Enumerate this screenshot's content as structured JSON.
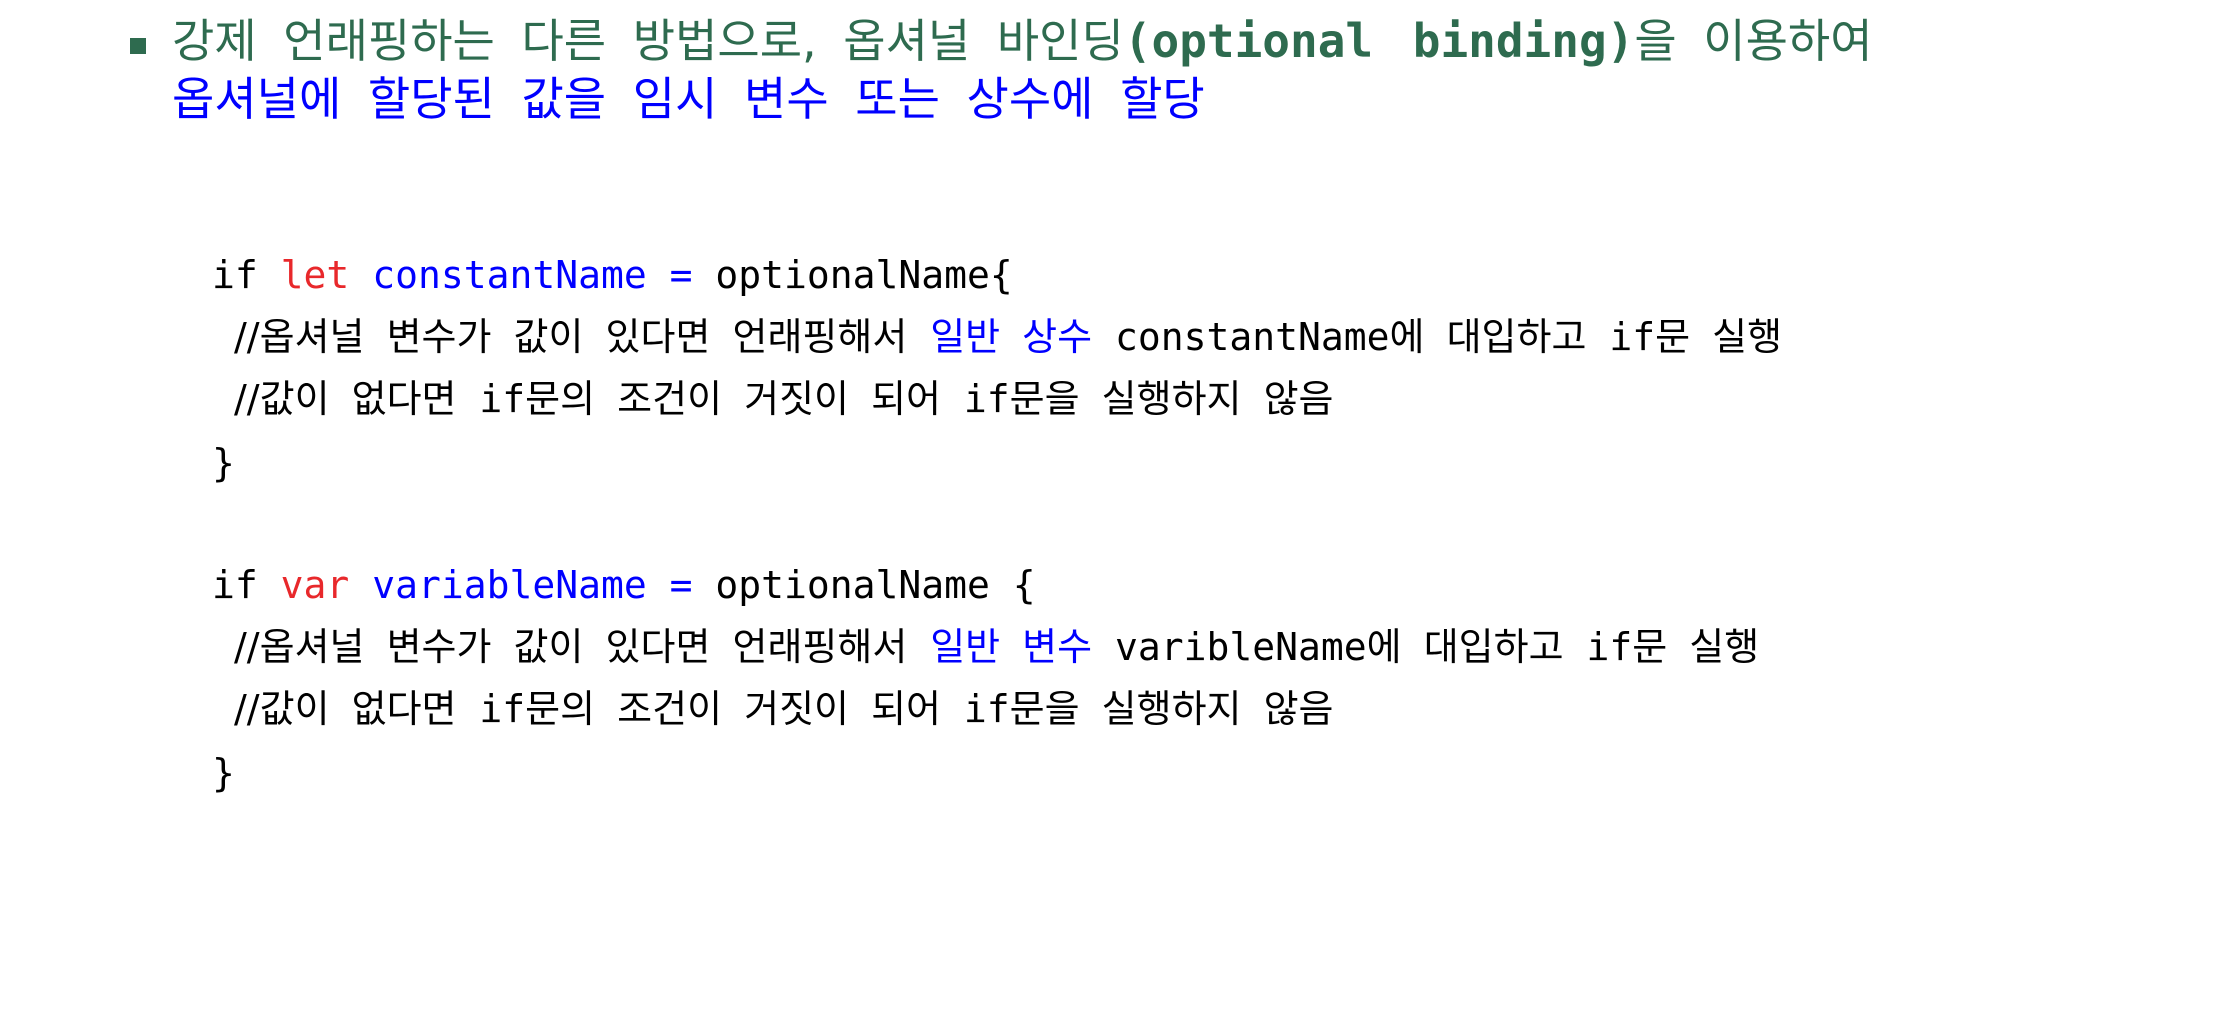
{
  "heading": {
    "line1_pre": "강제 언래핑하는 다른 방법으로,",
    "line1_mid": "옵셔널 바인딩",
    "line1_code": "(optional binding)",
    "line1_post": "을 이용하여",
    "line2": "옵셔널에 할당된 값을 임시 변수 또는 상수에 할당"
  },
  "code1": {
    "l1_if": "if",
    "l1_kw": "let",
    "l1_name": "constantName =",
    "l1_rest": "optionalName{",
    "l2_pre": "//옵셔널 변수가 값이 있다면 언래핑해서",
    "l2_blue": "일반 상수",
    "l2_code": "constantName",
    "l2_post": "에 대입하고",
    "l2_if": "if",
    "l2_end": "문 실행",
    "l3_pre": "//값이 없다면",
    "l3_if1": "if",
    "l3_mid": "문의 조건이 거짓이 되어",
    "l3_if2": "if",
    "l3_end": "문을 실행하지 않음",
    "close": "}"
  },
  "code2": {
    "l1_if": "if",
    "l1_kw": "var",
    "l1_name": "variableName =",
    "l1_rest": "optionalName {",
    "l2_pre": "//옵셔널 변수가 값이 있다면 언래핑해서",
    "l2_blue": "일반 변수",
    "l2_code": "varibleName",
    "l2_post": "에 대입하고",
    "l2_if": "if",
    "l2_end": "문 실행",
    "l3_pre": "//값이 없다면",
    "l3_if1": "if",
    "l3_mid": "문의 조건이 거짓이 되어",
    "l3_if2": "if",
    "l3_end": "문을 실행하지 않음",
    "close": "}"
  },
  "colors": {
    "heading_green": "#2e6b4f",
    "heading_blue": "#0000ff",
    "keyword_red": "#e8282b",
    "identifier_blue": "#0000ff"
  }
}
